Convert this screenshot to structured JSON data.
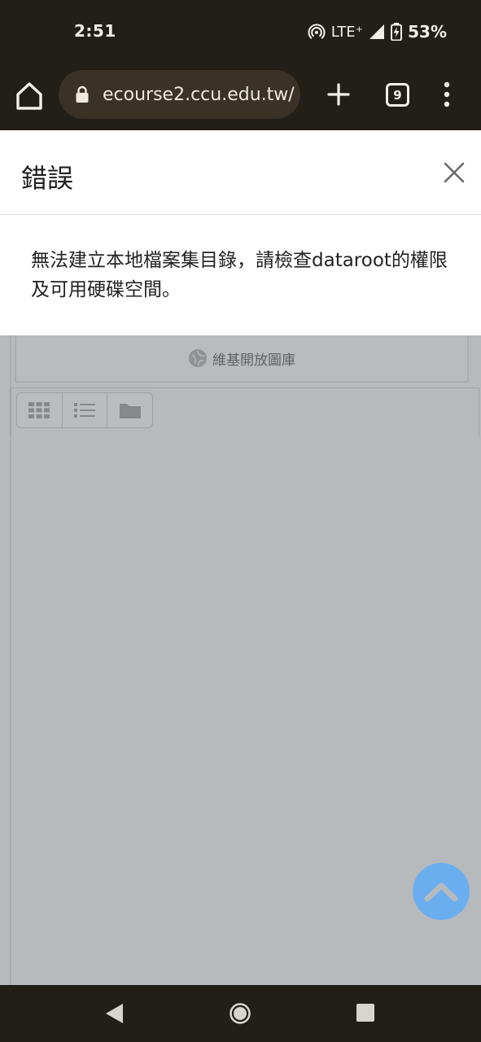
{
  "status_bar": {
    "time": "2:51",
    "network": "LTE⁺",
    "battery": "53%"
  },
  "browser": {
    "url": "ecourse2.ccu.edu.tw/",
    "tab_count": "9"
  },
  "dialog": {
    "title": "錯誤",
    "message": "無法建立本地檔案集目錄，請檢查dataroot的權限及可用硬碟空間。"
  },
  "page": {
    "repository_label": "維基開放圖庫"
  },
  "colors": {
    "system_bar": "#221e18",
    "url_pill": "#3a3226",
    "overlay_bg": "#b6babd",
    "scroll_top": "#6aaef0"
  },
  "icons": {
    "home": "home-icon",
    "lock": "lock-icon",
    "new_tab": "plus-icon",
    "menu": "more-vert-icon",
    "close": "close-icon",
    "grid_view": "grid-icon",
    "list_view": "list-icon",
    "folder_view": "folder-icon",
    "scroll_top": "chevron-up-icon"
  }
}
